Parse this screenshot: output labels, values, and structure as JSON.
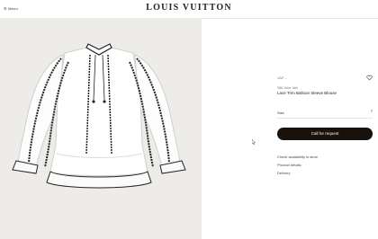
{
  "header": {
    "menu_label": "Menu",
    "brand": "LOUIS VUITTON"
  },
  "product": {
    "sku": "1AF…",
    "subtitle": "Silk Vine Veil",
    "name": "Lace Trim Balloon Sleeve Blouse",
    "size_label": "Size",
    "cta_label": "Call for request",
    "links": [
      "Check availability in store",
      "Product details",
      "Delivery"
    ]
  }
}
